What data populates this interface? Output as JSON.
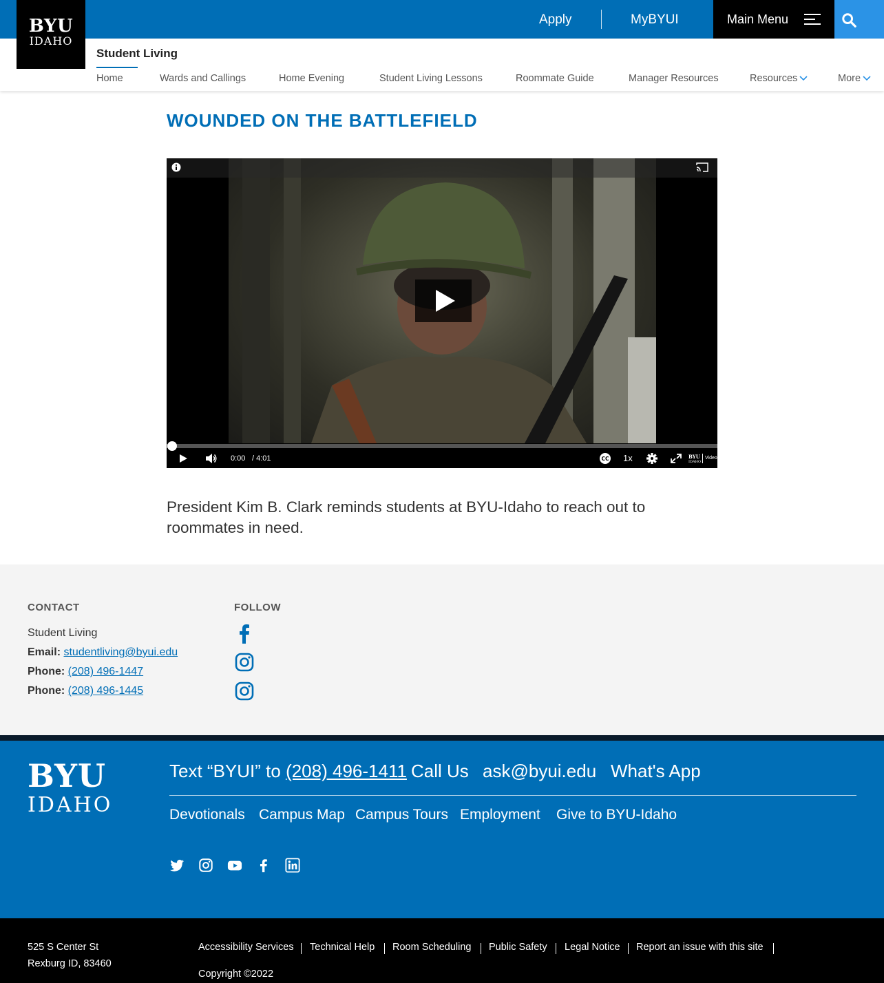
{
  "header": {
    "logo_line1": "BYU",
    "logo_line2": "IDAHO",
    "apply": "Apply",
    "mybyui": "MyBYUI",
    "main_menu": "Main Menu"
  },
  "subnav": {
    "site_title": "Student Living",
    "items": [
      "Home",
      "Wards and Callings",
      "Home Evening",
      "Student Living Lessons",
      "Roommate Guide",
      "Manager Resources",
      "Resources",
      "More"
    ]
  },
  "article": {
    "title": "WOUNDED ON THE BATTLEFIELD",
    "description": "President Kim B. Clark reminds students at BYU-Idaho to reach out to roommates in need."
  },
  "video": {
    "current_time": "0:00",
    "duration": "/ 4:01",
    "speed": "1x",
    "brand_line1": "BYU",
    "brand_line2": "IDAHO",
    "brand_label": "Video",
    "progress": 0
  },
  "contact": {
    "heading": "CONTACT",
    "org": "Student Living",
    "email_label": "Email:",
    "email": "studentliving@byui.edu",
    "phone_label": "Phone:",
    "phone1": "(208) 496-1447",
    "phone2": "(208) 496-1445"
  },
  "follow": {
    "heading": "FOLLOW",
    "icons": [
      "facebook-icon",
      "instagram-icon",
      "instagram-icon"
    ]
  },
  "footer": {
    "logo_line1": "BYU",
    "logo_line2": "IDAHO",
    "text_prefix": "Text “BYUI” to",
    "text_phone": "(208) 496-1411",
    "call_us": "Call Us",
    "email": "ask@byui.edu",
    "whats_app": "What's App",
    "links": [
      "Devotionals",
      "Campus Map",
      "Campus Tours",
      "Employment",
      "Give to BYU-Idaho"
    ],
    "social": [
      "twitter-icon",
      "instagram-icon",
      "youtube-icon",
      "facebook-icon",
      "linkedin-icon"
    ]
  },
  "bottom": {
    "address1": "525 S Center St",
    "address2": "Rexburg ID, 83460",
    "links": [
      "Accessibility Services",
      "Technical Help",
      "Room Scheduling",
      "Public Safety",
      "Legal Notice",
      "Report an issue with this site"
    ],
    "copyright": "Copyright ©2022"
  },
  "colors": {
    "brand_blue": "#006eb6",
    "search_blue": "#2b93e6",
    "footer_black": "#000000",
    "contact_bg": "#f4f4f4"
  }
}
